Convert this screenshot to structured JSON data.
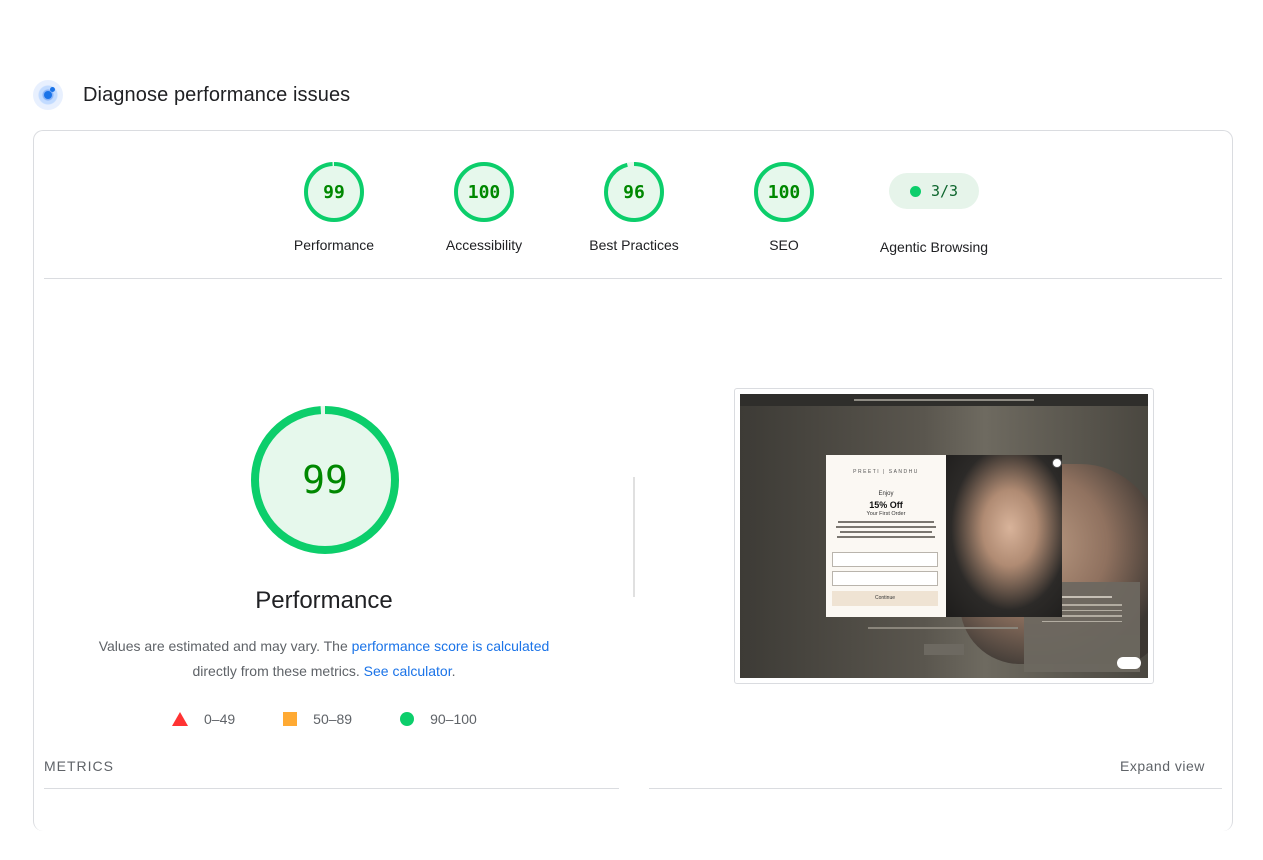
{
  "header": {
    "title": "Diagnose performance issues"
  },
  "gauges": [
    {
      "label": "Performance",
      "score": "99",
      "value": 99
    },
    {
      "label": "Accessibility",
      "score": "100",
      "value": 100
    },
    {
      "label": "Best Practices",
      "score": "96",
      "value": 96
    },
    {
      "label": "SEO",
      "score": "100",
      "value": 100
    }
  ],
  "agentic": {
    "label": "Agentic Browsing",
    "score": "3/3"
  },
  "performance": {
    "score": "99",
    "value": 99,
    "title": "Performance",
    "desc_prefix": "Values are estimated and may vary. The ",
    "desc_link": "performance score is calculated",
    "desc_middle": "directly from these metrics.",
    "desc_link2": "See calculator",
    "desc_suffix": "."
  },
  "legend": [
    {
      "label": "0–49",
      "shape": "triangle",
      "color": "#ff3333"
    },
    {
      "label": "50–89",
      "shape": "square",
      "color": "#ffaa33"
    },
    {
      "label": "90–100",
      "shape": "circle",
      "color": "#0cce6b"
    }
  ],
  "screenshot": {
    "popup_brand": "PREETI | SANDHU",
    "popup_enjoy": "Enjoy",
    "popup_offer": "15% Off",
    "popup_subtitle": "Your First Order",
    "popup_button": "Continue"
  },
  "metrics": {
    "label": "METRICS",
    "expand": "Expand view"
  },
  "colors": {
    "pass": "#0cce6b",
    "pass_text": "#008800",
    "pass_fill": "#e6f8ec",
    "link": "#1a73e8"
  }
}
